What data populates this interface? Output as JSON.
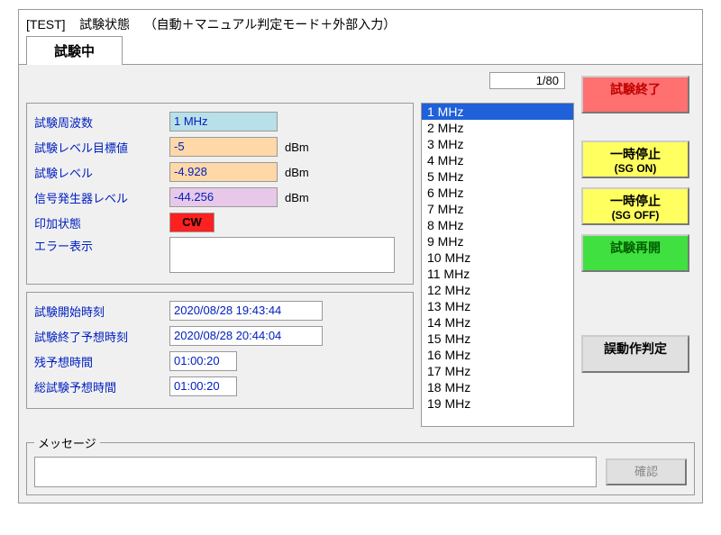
{
  "title": {
    "prefix": "[TEST]",
    "state": "試験状態",
    "mode": "（自動＋マニュアル判定モード＋外部入力）"
  },
  "tab_label": "試験中",
  "step_counter": "1/80",
  "params": {
    "freq": {
      "label": "試験周波数",
      "value": "1 MHz",
      "unit": ""
    },
    "level_target": {
      "label": "試験レベル目標値",
      "value": "-5",
      "unit": "dBm"
    },
    "level": {
      "label": "試験レベル",
      "value": "-4.928",
      "unit": "dBm"
    },
    "sg_level": {
      "label": "信号発生器レベル",
      "value": "-44.256",
      "unit": "dBm"
    },
    "apply_state": {
      "label": "印加状態",
      "value": "CW"
    },
    "error": {
      "label": "エラー表示",
      "value": ""
    }
  },
  "times": {
    "start": {
      "label": "試験開始時刻",
      "value": "2020/08/28  19:43:44"
    },
    "end_est": {
      "label": "試験終了予想時刻",
      "value": "2020/08/28  20:44:04"
    },
    "remain_est": {
      "label": "残予想時間",
      "value": "01:00:20"
    },
    "total_est": {
      "label": "総試験予想時間",
      "value": "01:00:20"
    }
  },
  "freq_list": [
    "1 MHz",
    "2 MHz",
    "3 MHz",
    "4 MHz",
    "5 MHz",
    "6 MHz",
    "7 MHz",
    "8 MHz",
    "9 MHz",
    "10 MHz",
    "11 MHz",
    "12 MHz",
    "13 MHz",
    "14 MHz",
    "15 MHz",
    "16 MHz",
    "17 MHz",
    "18 MHz",
    "19 MHz"
  ],
  "freq_list_selected": 0,
  "buttons": {
    "end": "試験終了",
    "pause_on": {
      "line1": "一時停止",
      "line2": "(SG ON)"
    },
    "pause_off": {
      "line1": "一時停止",
      "line2": "(SG OFF)"
    },
    "resume": "試験再開",
    "malfunction": "誤動作判定"
  },
  "message_box": {
    "legend": "メッセージ",
    "confirm": "確認",
    "text": ""
  }
}
